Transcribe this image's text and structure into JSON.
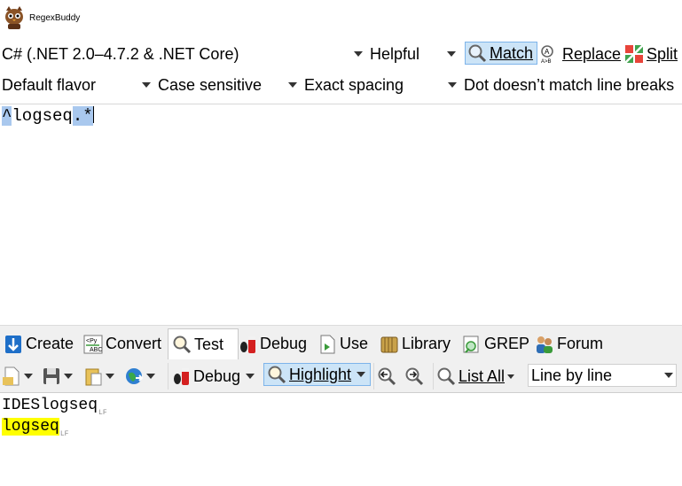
{
  "app": {
    "title": "RegexBuddy"
  },
  "row1": {
    "language": "C# (.NET 2.0–4.7.2 & .NET Core)",
    "helpfulness": "Helpful",
    "match_label": "Match",
    "replace_label": "Replace",
    "split_label": "Split"
  },
  "row2": {
    "flavor": "Default flavor",
    "case": "Case sensitive",
    "spacing": "Exact spacing",
    "dot": "Dot doesn’t match line breaks"
  },
  "regex": {
    "anchor": "^",
    "literal": "logseq",
    "dotstar": ".*"
  },
  "tabs": [
    {
      "label": "Create",
      "icon": "create-icon"
    },
    {
      "label": "Convert",
      "icon": "convert-icon"
    },
    {
      "label": "Test",
      "icon": "test-icon"
    },
    {
      "label": "Debug",
      "icon": "debug-icon"
    },
    {
      "label": "Use",
      "icon": "use-icon"
    },
    {
      "label": "Library",
      "icon": "library-icon"
    },
    {
      "label": "GREP",
      "icon": "grep-icon"
    },
    {
      "label": "Forum",
      "icon": "forum-icon"
    }
  ],
  "test_toolbar": {
    "debug_label": "Debug",
    "highlight_label": "Highlight",
    "list_all_label": "List All",
    "line_mode": "Line by line"
  },
  "test_text": {
    "line1": "IDESlogseq",
    "line1_eol": "LF",
    "line2": "logseq",
    "line2_eol": "LF"
  },
  "colors": {
    "match_highlight": "#ffff00",
    "regex_highlight": "#a9c8ee",
    "pressed": "#cce4f7"
  }
}
